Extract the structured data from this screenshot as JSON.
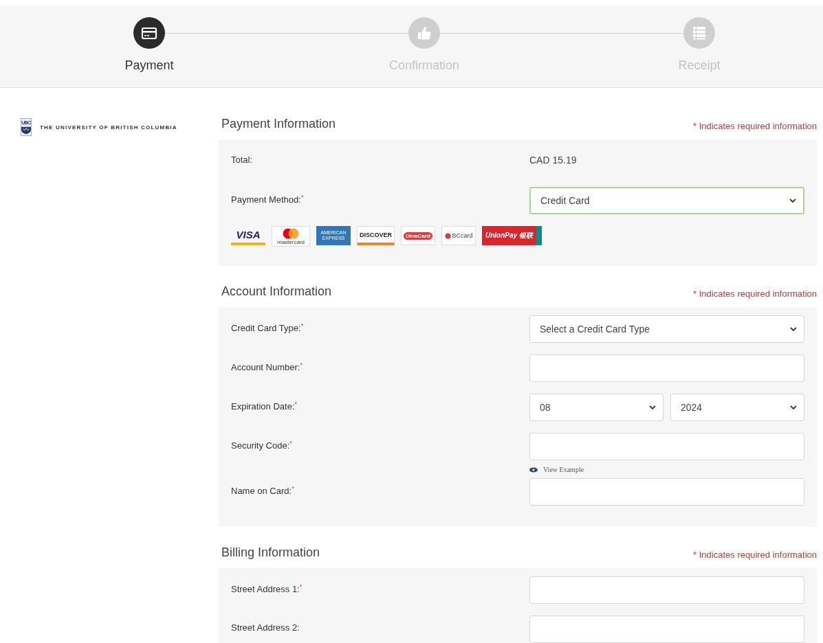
{
  "steps": [
    {
      "kind": "card",
      "label": "Payment",
      "selected": true
    },
    {
      "kind": "thumb",
      "label": "Confirmation",
      "selected": false
    },
    {
      "kind": "list",
      "label": "Receipt",
      "selected": false
    }
  ],
  "logo": {
    "mark": "UBC",
    "name": "THE UNIVERSITY OF BRITISH COLUMBIA"
  },
  "sections": [
    {
      "title": "Payment Information",
      "note": "* Indicates required information",
      "rows": [
        {
          "kind": "static",
          "label": "Total:",
          "value": "CAD 15.19"
        },
        {
          "kind": "controls",
          "label": "Payment Method:$^{*}$",
          "controls": [
            {
              "kind": "select",
              "value": "Credit Card",
              "focused": true
            }
          ]
        },
        {
          "kind": "cards",
          "cards": [
            {
              "kind": "visa",
              "text": "VISA"
            },
            {
              "kind": "mastercard",
              "text": "mastercard"
            },
            {
              "kind": "amex",
              "text": "AMERICAN EXPRESS"
            },
            {
              "kind": "discover",
              "text": "DISCOVER"
            },
            {
              "kind": "dina",
              "text": "DinaCard"
            },
            {
              "kind": "bc",
              "text": "BCcard"
            },
            {
              "kind": "unionpay",
              "text": "UnionPay 银联"
            }
          ]
        }
      ]
    },
    {
      "title": "Account Information",
      "note": "* Indicates required information",
      "rows": [
        {
          "kind": "controls",
          "label": "Credit Card Type:$^{*}$",
          "controls": [
            {
              "kind": "select",
              "value": "Select a Credit Card Type",
              "focused": false
            }
          ]
        },
        {
          "kind": "controls",
          "label": "Account Number:$^{*}$",
          "controls": [
            {
              "kind": "input",
              "focused": false
            }
          ]
        },
        {
          "kind": "controls",
          "label": "Expiration Date:$^{*}$",
          "controls": [
            {
              "kind": "select",
              "value": "08",
              "focused": false
            },
            {
              "kind": "select",
              "value": "2024",
              "focused": false
            }
          ]
        },
        {
          "kind": "controls",
          "label": "Security Code:$^{*}$",
          "controls": [
            {
              "kind": "input",
              "focused": false
            }
          ],
          "link": "View Example"
        },
        {
          "kind": "controls",
          "label": "Name on Card:$^{*}$",
          "controls": [
            {
              "kind": "input",
              "focused": false
            }
          ]
        }
      ]
    },
    {
      "title": "Billing Information",
      "note": "* Indicates required information",
      "rows": [
        {
          "kind": "controls",
          "label": "Street Address 1:$^{*}$",
          "controls": [
            {
              "kind": "input",
              "focused": false
            }
          ]
        },
        {
          "kind": "controls",
          "label": "Street Address 2:",
          "controls": [
            {
              "kind": "input",
              "focused": false
            }
          ]
        }
      ]
    }
  ]
}
